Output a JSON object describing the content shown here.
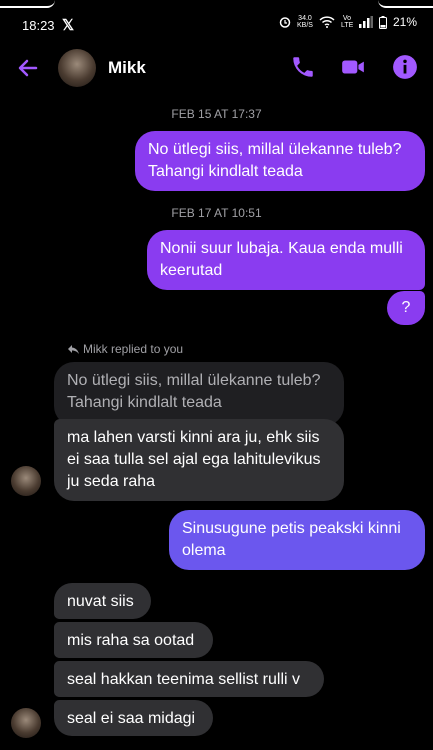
{
  "status_bar": {
    "time": "18:23",
    "x_logo": "𝕏",
    "net_speed_top": "34.0",
    "net_speed_bottom": "KB/S",
    "signal_label": "Vo LTE",
    "battery": "21%"
  },
  "header": {
    "contact_name": "Mikk",
    "accent_color": "#a259ff"
  },
  "conversation": {
    "timestamp_1": "FEB 15 AT 17:37",
    "msg_1": "No ütlegi siis, millal ülekanne tuleb? Tahangi kindlalt teada",
    "timestamp_2": "FEB 17 AT 10:51",
    "msg_2": "Nonii suur lubaja. Kaua enda mulli keerutad",
    "msg_3": "?",
    "reply_label": "Mikk replied to you",
    "quoted_msg": "No ütlegi siis, millal ülekanne tuleb? Tahangi kindlalt teada",
    "msg_4": "ma lahen varsti kinni ara ju, ehk siis ei saa tulla sel ajal ega lahitulevikus ju seda raha",
    "msg_5": "Sinusugune petis peakski kinni olema",
    "msg_6": "nuvat siis",
    "msg_7": "mis raha sa ootad",
    "msg_8": "seal hakkan teenima sellist rulli v",
    "msg_9": "seal ei saa midagi"
  },
  "colors": {
    "outgoing_purple": "#8a3cf0",
    "outgoing_blue": "#6b57ee",
    "incoming": "#303033"
  }
}
